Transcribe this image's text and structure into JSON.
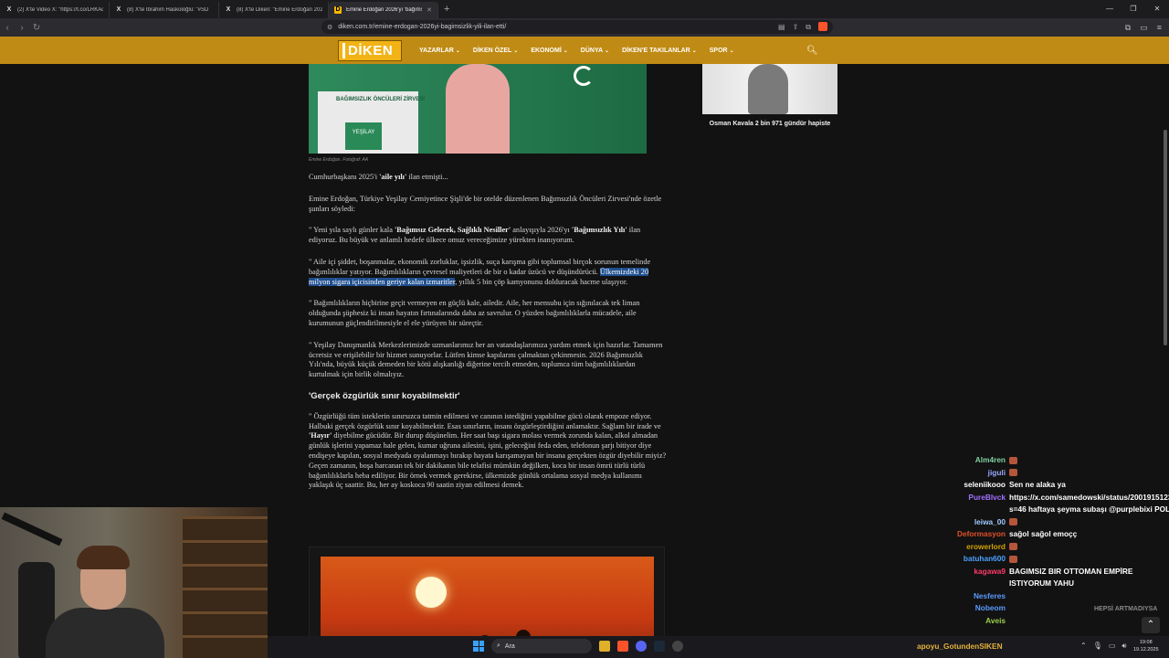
{
  "browser": {
    "tabs": [
      {
        "label": "(2) X'te Video X: \"https://t.co/LRKAq",
        "icon": "x-logo-icon",
        "active": false
      },
      {
        "label": "(8) X'te İbrahim Haskoloğlu: \"#SD",
        "icon": "x-logo-icon",
        "active": false
      },
      {
        "label": "(8) X'te Diken: \"Emine Erdoğan 2026",
        "icon": "x-logo-icon",
        "active": false
      },
      {
        "label": "Emine Erdoğan 2026'yı 'bağımsı",
        "icon": "diken-favicon",
        "active": true
      }
    ],
    "url": "diken.com.tr/emine-erdogan-2026yi-bagimsizlik-yili-ilan-etti/",
    "shield_count": "9"
  },
  "site": {
    "logo": "DİKEN",
    "menu": [
      "YAZARLAR",
      "DİKEN ÖZEL",
      "EKONOMİ",
      "DÜNYA",
      "DİKEN'E TAKILANLAR",
      "SPOR"
    ]
  },
  "article": {
    "image1_caption": "Emine Erdoğan. Fotoğraf: AA",
    "podium_text": "BAĞIMSIZLIK ÖNCÜLERİ ZİRVESİ",
    "podium_brand": "YEŞİLAY",
    "p1_a": "Cumhurbaşkanı 2025'i ",
    "p1_b": "'aile yılı'",
    "p1_c": " ilan etmişti...",
    "p2": "Emine Erdoğan, Türkiye Yeşilay Cemiyetince Şişli'de bir otelde düzenlenen Bağımsızlık Öncüleri Zirvesi'nde özetle şunları söyledi:",
    "p3_a": "\" Yeni yıla saylı günler kala ",
    "p3_b": "'Bağımsız Gelecek, Sağlıklı Nesiller'",
    "p3_c": " anlayışıyla 2026'yı ",
    "p3_d": "'Bağımsızlık Yılı'",
    "p3_e": " ilan ediyoruz. Bu büyük ve anlamlı hedefe ülkece omuz vereceğimize yürekten inanıyorum.",
    "p4_a": "\" Aile içi şiddet, boşanmalar, ekonomik zorluklar, işsizlik, suça karışma gibi toplumsal birçok sorunun temelinde bağımlılıklar yatıyor. Bağımlılıkların çevresel maliyetleri de bir o kadar üzücü ve düşündürücü. ",
    "p4_hl": "Ülkemizdeki 20 milyon sigara içicisinden geriye kalan izmaritler",
    "p4_c": ", yıllık 5 bin çöp kamyonunu dolduracak hacme ulaşıyor.",
    "p5": "\" Bağımlılıkların hiçbirine geçit vermeyen en güçlü kale, ailedir. Aile, her mensubu için sığınılacak tek liman olduğunda şüphesiz ki insan hayatın fırtınalarında daha az savrulur. O yüzden bağımlılıklarla mücadele, aile kurumunun güçlendirilmesiyle el ele yürüyen bir süreçtir.",
    "p6": "\" Yeşilay Danışmanlık Merkezlerimizde uzmanlarımız her an vatandaşlarımıza yardım etmek için hazırlar. Tamamen ücretsiz ve erişilebilir bir hizmet sunuyorlar. Lütfen kimse kapılarını çalmaktan çekinmesin. 2026 Bağımsızlık Yılı'nda, büyük küçük demeden bir kötü alışkanlığı diğerine tercih etmeden, toplumca tüm bağımlılıklardan kurtulmak için birlik olmalıyız.",
    "heading": "'Gerçek özgürlük sınır koyabilmektir'",
    "p7_a": "\" Özgürlüğü tüm isteklerin sınırsızca tatmin edilmesi ve canının istediğini yapabilme gücü olarak empoze ediyor. Halbuki gerçek özgürlük sınır koyabilmektir. Esas sınırların, insanı özgürleştirdiğini anlamaktır. Sağlam bir irade ve ",
    "p7_b": "'Hayır'",
    "p7_c": " diyebilme gücüdür. Bir durup düşünelim. Her saat başı sigara molası vermek zorunda kalan, alkol almadan günlük işlerini yapamaz hale gelen, kumar uğruna ailesini, işini, geleceğini feda eden, telefonun şarjı bitiyor diye endişeye kapılan, sosyal medyada oyalanmayı bırakıp hayata karışamayan bir insana gerçekten özgür diyebilir miyiz? Geçen zamanın, boşa harcanan tek bir dakikanın bile telafisi mümkün değilken, koca bir insan ömrü türlü türlü bağımlılıklarla heba ediliyor. Bir örnek vermek gerekirse, ülkemizde günlük ortalama sosyal medya kullanımı yaklaşık üç saattir. Bu, her ay koskoca 90 saatin ziyan edilmesi demek."
  },
  "sidebar": {
    "caption": "Osman Kavala 2 bin 971 gündür hapiste"
  },
  "chat": {
    "messages": [
      {
        "user": "Alm4ren",
        "color": "#7fd0a0",
        "text": "",
        "emote": true
      },
      {
        "user": "jiguli",
        "color": "#9aa8ff",
        "text": "",
        "emote": true
      },
      {
        "user": "seleniikooo",
        "color": "#ffffff",
        "text": "Sen ne alaka ya",
        "emote": false
      },
      {
        "user": "PureBlvck",
        "color": "#a070ff",
        "text": "https://x.com/samedowski/status/2001915123217371182?s=46 haftaya şeyma subaşı @purplebixi POLICE",
        "emote": false
      },
      {
        "user": "leiwa_00",
        "color": "#a0c8ff",
        "text": "",
        "emote": true
      },
      {
        "user": "Deformasyon",
        "color": "#e0502a",
        "text": "sağol sağol emoçç",
        "emote": false
      },
      {
        "user": "erowerlord",
        "color": "#d2a000",
        "text": "",
        "emote": true
      },
      {
        "user": "batuhan600",
        "color": "#4aa0ff",
        "text": "",
        "emote": true
      },
      {
        "user": "kagawa9",
        "color": "#ff3a6a",
        "text": "BAGIMSIZ BIR OTTOMAN EMPİRE ISTIYORUM YAHU",
        "emote": false
      },
      {
        "user": "Nesferes",
        "color": "#5a9aff",
        "text": "",
        "emote": false
      },
      {
        "user": "Nobeom",
        "color": "#5a9aff",
        "text": "",
        "emote": false
      },
      {
        "user": "Aveis",
        "color": "#9ad04a",
        "text": "",
        "emote": false
      }
    ],
    "overlay_text": "HEPSİ ARTMADIYSA",
    "streamer": "apoyu_GotundenSIKEN"
  },
  "taskbar": {
    "search_placeholder": "Ara",
    "time": "19:08",
    "date": "19.12.2025"
  }
}
